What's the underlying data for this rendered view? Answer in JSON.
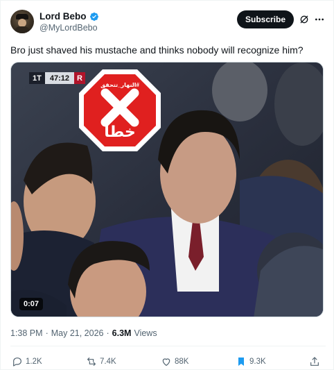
{
  "author": {
    "display_name": "Lord Bebo",
    "handle": "@MyLordBebo",
    "verified": true
  },
  "header": {
    "subscribe_label": "Subscribe",
    "icons": [
      "grok-icon",
      "more-icon"
    ]
  },
  "tweet": {
    "text": "Bro just shaved his mustache and thinks nobody will recognize him?"
  },
  "media": {
    "score_half": "1T",
    "score_time": "47:12",
    "score_team": "R",
    "stamp_top_text": "النهار_تتحقق#",
    "stamp_bottom_text": "خطأ",
    "duration": "0:07"
  },
  "meta": {
    "time": "1:38 PM",
    "separator": "·",
    "date": "May 21, 2026",
    "views_count": "6.3M",
    "views_label": "Views"
  },
  "actions": {
    "replies": "1.2K",
    "reposts": "7.4K",
    "likes": "88K",
    "bookmarks": "9.3K"
  },
  "colors": {
    "accent": "#1d9bf0",
    "text": "#0f1419",
    "muted": "#536471",
    "stamp_red": "#e0201f",
    "bookmark_blue": "#1d9bf0"
  }
}
